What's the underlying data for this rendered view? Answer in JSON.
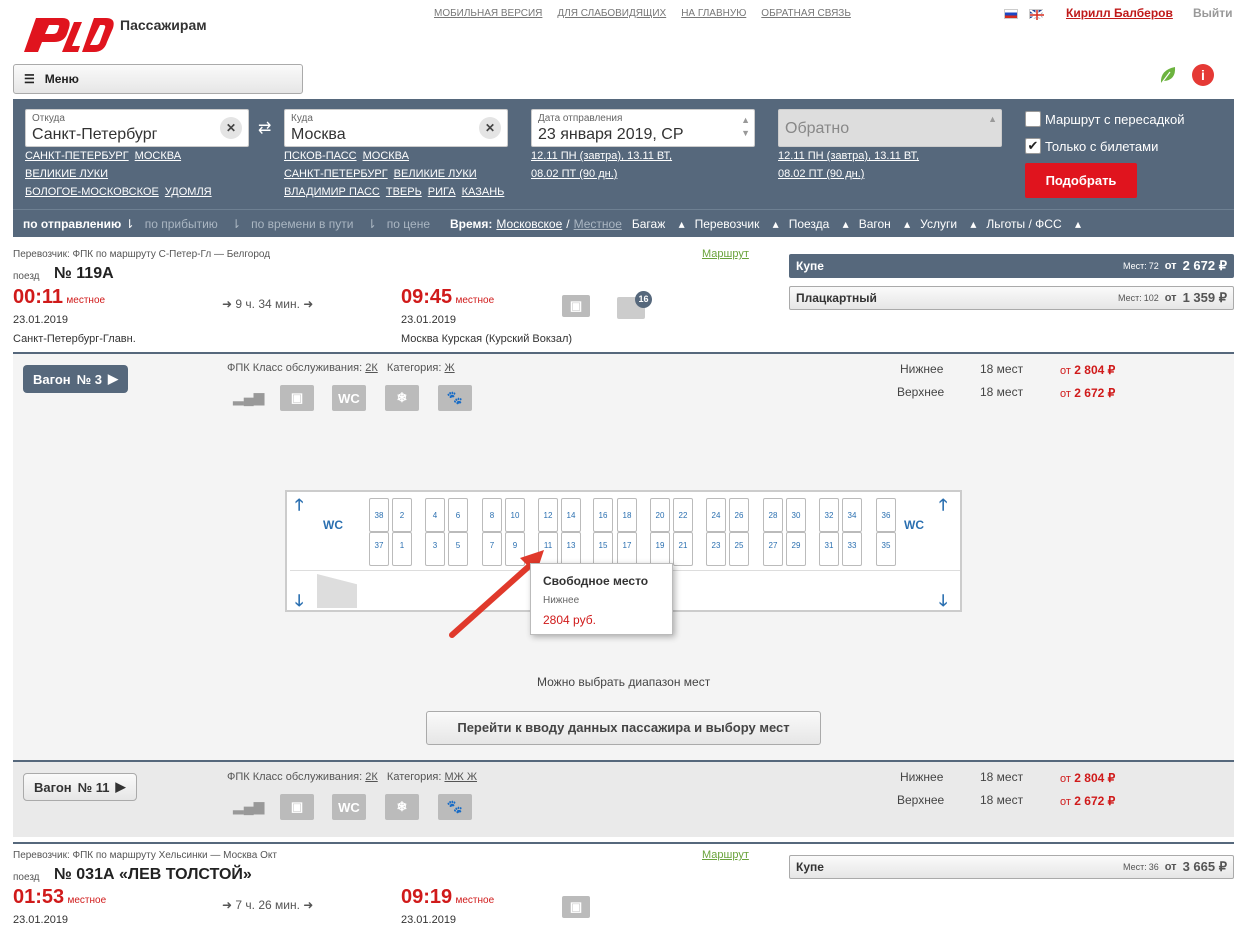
{
  "header": {
    "logo_text": "Пассажирам",
    "links": [
      "МОБИЛЬНАЯ ВЕРСИЯ",
      "ДЛЯ СЛАБОВИДЯЩИХ",
      "НА ГЛАВНУЮ",
      "ОБРАТНАЯ СВЯЗЬ"
    ],
    "user": "Кирилл Балберов",
    "logout": "Выйти",
    "menu": "Меню"
  },
  "search": {
    "from_label": "Откуда",
    "from_value": "Санкт-Петербург",
    "from_sugg": [
      "САНКТ-ПЕТЕРБУРГ",
      "МОСКВА",
      "ВЕЛИКИЕ ЛУКИ",
      "БОЛОГОЕ-МОСКОВСКОЕ",
      "УДОМЛЯ"
    ],
    "to_label": "Куда",
    "to_value": "Москва",
    "to_sugg": [
      "ПСКОВ-ПАСС",
      "МОСКВА",
      "САНКТ-ПЕТЕРБУРГ",
      "ВЕЛИКИЕ ЛУКИ",
      "ВЛАДИМИР ПАСС",
      "ТВЕРЬ",
      "РИГА",
      "КАЗАНЬ"
    ],
    "date_label": "Дата отправления",
    "date_value": "23 января 2019, СР",
    "date_sugg": [
      "12.11 ПН (завтра), 13.11 ВТ,",
      "08.02 ПТ (90 дн.)"
    ],
    "return_placeholder": "Обратно",
    "return_sugg": [
      "12.11 ПН (завтра), 13.11 ВТ,",
      "08.02 ПТ (90 дн.)"
    ],
    "chk_transfer": "Маршрут с пересадкой",
    "chk_tickets": "Только с билетами",
    "submit": "Подобрать"
  },
  "sortbar": {
    "by_departure": "по отправлению",
    "by_arrival": "по прибытию",
    "by_travel": "по времени в пути",
    "by_price": "по цене",
    "time_label": "Время:",
    "time_moscow": "Московское",
    "time_slash": "/",
    "time_local": "Местное",
    "filters": [
      "Багаж",
      "Перевозчик",
      "Поезда",
      "Вагон",
      "Услуги",
      "Льготы / ФСС"
    ]
  },
  "train1": {
    "carrier": "Перевозчик: ФПК   по маршруту С-Петер-Гл — Белгород",
    "route_link": "Маршрут",
    "train_label": "поезд",
    "number": "№ 119А",
    "dep_time": "00:11",
    "dep_local": "местное",
    "dep_date": "23.01.2019",
    "dep_station": "Санкт-Петербург-Главн.",
    "duration": "9 ч. 34 мин.",
    "arr_time": "09:45",
    "arr_local": "местное",
    "arr_date": "23.01.2019",
    "arr_station": "Москва Курская (Курский Вокзал)",
    "badge": "16",
    "classes": [
      {
        "name": "Купе",
        "seats_label": "Мест:",
        "seats": "72",
        "ot": "от",
        "price": "2 672 ₽"
      },
      {
        "name": "Плацкартный",
        "seats_label": "Мест:",
        "seats": "102",
        "ot": "от",
        "price": "1 359 ₽"
      }
    ]
  },
  "wagon3": {
    "btn": "Вагон",
    "num": "№ 3",
    "info": "ФПК   Класс обслуживания:",
    "class": "2К",
    "cat_label": "Категория:",
    "cat": "Ж",
    "lower": "Нижнее",
    "lower_seats": "18 мест",
    "lower_ot": "от",
    "lower_price": "2 804 ₽",
    "upper": "Верхнее",
    "upper_seats": "18 мест",
    "upper_ot": "от",
    "upper_price": "2 672 ₽",
    "wc": "WC",
    "tooltip_title": "Свободное место",
    "tooltip_tier": "Нижнее",
    "tooltip_price": "2804 руб.",
    "range_note": "Можно выбрать диапазон мест",
    "proceed": "Перейти к вводу данных пассажира и выбору мест"
  },
  "wagon11": {
    "btn": "Вагон",
    "num": "№ 11",
    "info": "ФПК   Класс обслуживания:",
    "class": "2К",
    "cat_label": "Категория:",
    "cat": "МЖ Ж",
    "lower": "Нижнее",
    "lower_seats": "18 мест",
    "lower_ot": "от",
    "lower_price": "2 804 ₽",
    "upper": "Верхнее",
    "upper_seats": "18 мест",
    "upper_ot": "от",
    "upper_price": "2 672 ₽"
  },
  "train2": {
    "carrier": "Перевозчик: ФПК   по маршруту Хельсинки — Москва Окт",
    "route_link": "Маршрут",
    "train_label": "поезд",
    "number": "№ 031А «ЛЕВ ТОЛСТОЙ»",
    "dep_time": "01:53",
    "dep_local": "местное",
    "dep_date": "23.01.2019",
    "duration": "7 ч. 26 мин.",
    "arr_time": "09:19",
    "arr_local": "местное",
    "arr_date": "23.01.2019",
    "class": {
      "name": "Купе",
      "seats_label": "Мест:",
      "seats": "36",
      "ot": "от",
      "price": "3 665 ₽"
    }
  },
  "seats": [
    {
      "up": "38",
      "low": "37"
    },
    {
      "up": "2",
      "low": "1"
    },
    {
      "up": "4",
      "low": "3"
    },
    {
      "up": "6",
      "low": "5"
    },
    {
      "up": "8",
      "low": "7"
    },
    {
      "up": "10",
      "low": "9"
    },
    {
      "up": "12",
      "low": "11"
    },
    {
      "up": "14",
      "low": "13"
    },
    {
      "up": "16",
      "low": "15"
    },
    {
      "up": "18",
      "low": "17"
    },
    {
      "up": "20",
      "low": "19"
    },
    {
      "up": "22",
      "low": "21"
    },
    {
      "up": "24",
      "low": "23"
    },
    {
      "up": "26",
      "low": "25"
    },
    {
      "up": "28",
      "low": "27"
    },
    {
      "up": "30",
      "low": "29"
    },
    {
      "up": "32",
      "low": "31"
    },
    {
      "up": "34",
      "low": "33"
    },
    {
      "up": "36",
      "low": "35"
    }
  ]
}
